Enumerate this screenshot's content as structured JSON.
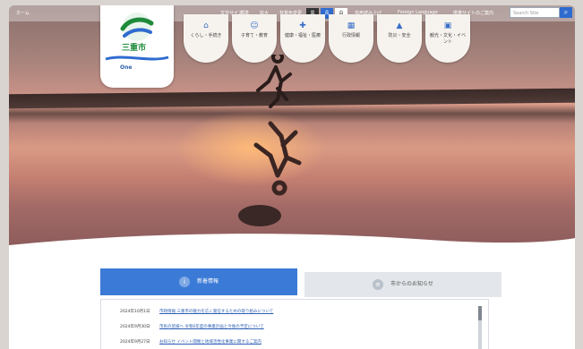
{
  "topbar": {
    "left_text": "ホーム",
    "links": [
      "文字サイズ",
      "標準",
      "拡大",
      "背景色変更",
      "黒",
      "青",
      "白",
      "音声読み上げ",
      "Foreign Language",
      "携帯サイトのご案内"
    ],
    "search_placeholder": "Search Site",
    "search_icon": "search-icon"
  },
  "logo": {
    "city_name": "三重市",
    "tagline": "One",
    "sub": "三重市ロゴ",
    "icon": "wave-logo-icon"
  },
  "categories": [
    {
      "label": "くらし・手続き",
      "icon": "home-icon"
    },
    {
      "label": "子育て・教育",
      "icon": "child-icon"
    },
    {
      "label": "健康・福祉・医療",
      "icon": "health-icon"
    },
    {
      "label": "行政情報",
      "icon": "building-icon"
    },
    {
      "label": "防災・安全",
      "icon": "shield-icon"
    },
    {
      "label": "観光・文化・イベント",
      "icon": "camera-icon"
    }
  ],
  "tabs": {
    "active": {
      "label": "新着情報",
      "icon": "info-icon"
    },
    "inactive": {
      "label": "市からのお知らせ",
      "icon": "list-icon"
    }
  },
  "news": [
    {
      "date": "2024年10月1日",
      "title": "市政情報 三重市の魅力を広く発信するための取り組みについて"
    },
    {
      "date": "2024年9月30日",
      "title": "市民の皆様へ 令和6年度の事業計画と今後の予定について"
    },
    {
      "date": "2024年9月27日",
      "title": "お知らせ イベント開催と地域活性化事業に関するご案内"
    }
  ],
  "colors": {
    "accent": "#3b7ad6",
    "logo_green": "#1f8a3a",
    "link": "#2b5fb3"
  }
}
